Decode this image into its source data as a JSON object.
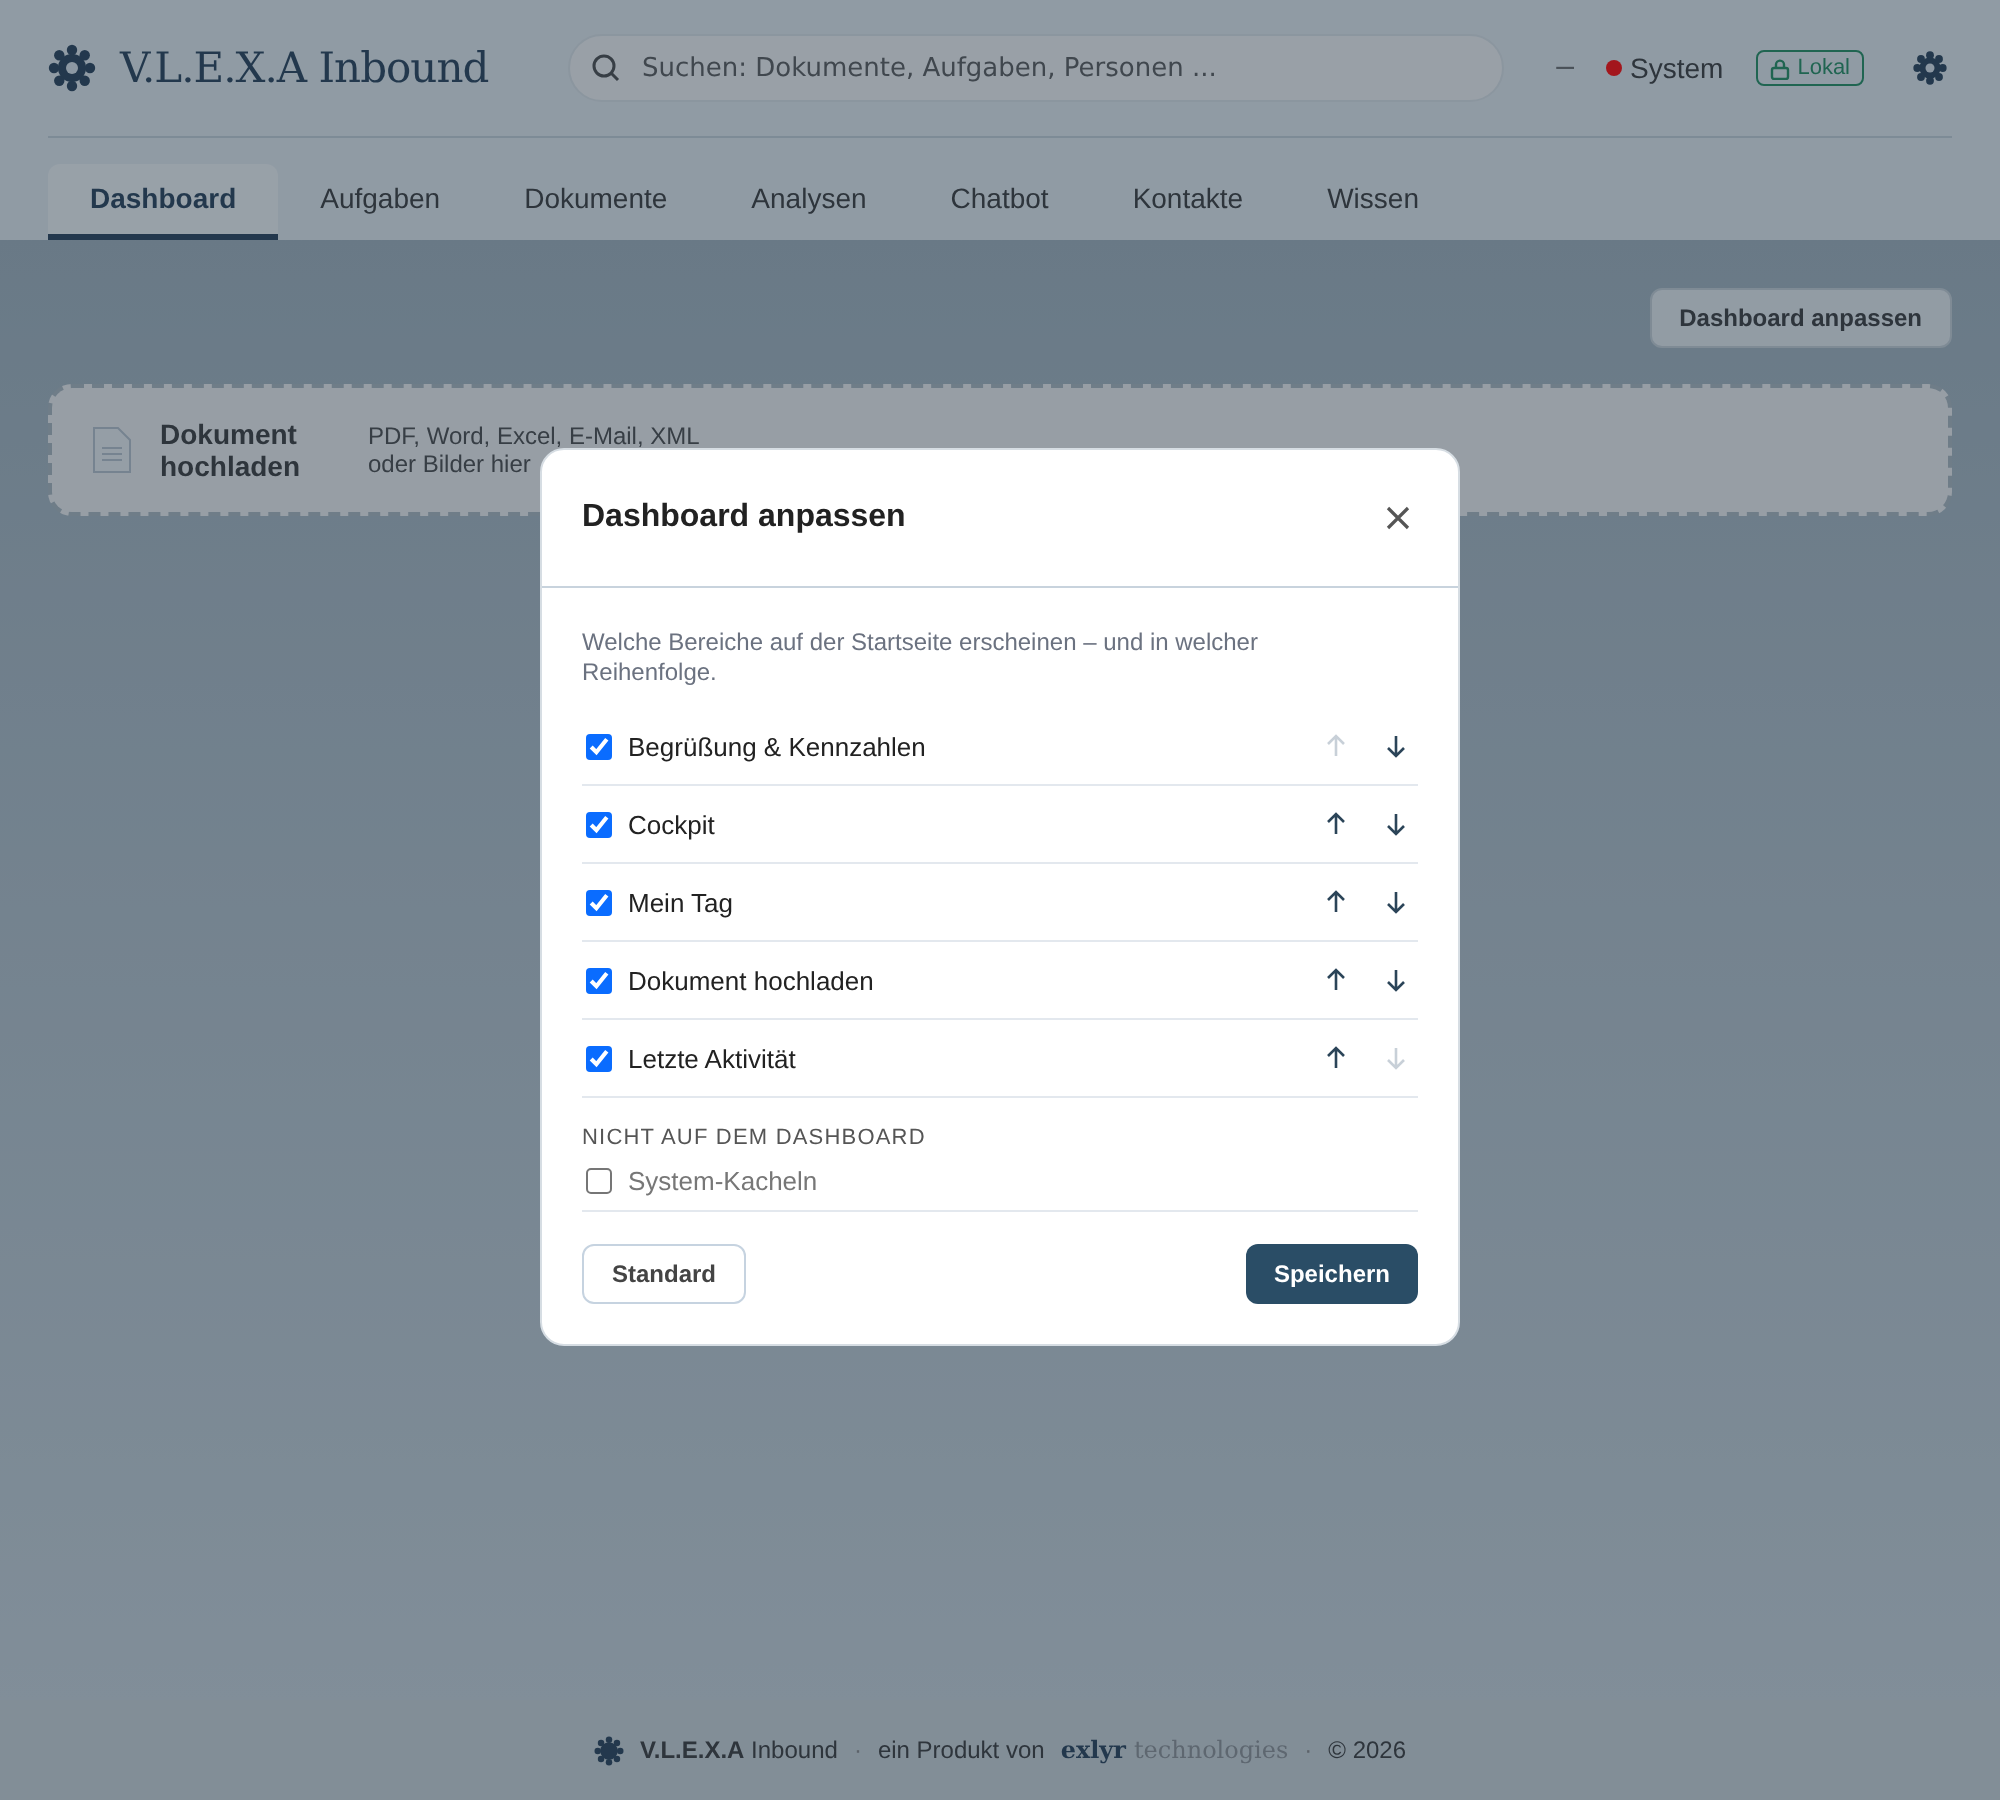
{
  "header": {
    "brand": "V.L.E.X.A Inbound",
    "search": {
      "placeholder": "Suchen: Dokumente, Aufgaben, Personen ..."
    },
    "dash": "–",
    "status": {
      "label": "System",
      "color": "#a3161c"
    },
    "badge": "Lokal"
  },
  "tabs": [
    {
      "label": "Dashboard",
      "selected": true
    },
    {
      "label": "Aufgaben",
      "selected": false
    },
    {
      "label": "Dokumente",
      "selected": false
    },
    {
      "label": "Analysen",
      "selected": false
    },
    {
      "label": "Chatbot",
      "selected": false
    },
    {
      "label": "Kontakte",
      "selected": false
    },
    {
      "label": "Wissen",
      "selected": false
    }
  ],
  "customize_button": "Dashboard anpassen",
  "upload_card": {
    "title": "Dokument hochladen",
    "line_1": "PDF, Word, Excel, E-Mail, XML",
    "line_2": "oder Bilder hier"
  },
  "dialog": {
    "title": "Dashboard anpassen",
    "intro": "Welche Bereiche auf der Startseite erscheinen – und in welcher Reihenfolge.",
    "sections": [
      {
        "label": "Begrüßung & Kennzahlen",
        "checked": true,
        "up_disabled": true,
        "down_disabled": false
      },
      {
        "label": "Cockpit",
        "checked": true,
        "up_disabled": false,
        "down_disabled": false
      },
      {
        "label": "Mein Tag",
        "checked": true,
        "up_disabled": false,
        "down_disabled": false
      },
      {
        "label": "Dokument hochladen",
        "checked": true,
        "up_disabled": false,
        "down_disabled": false
      },
      {
        "label": "Letzte Aktivität",
        "checked": true,
        "up_disabled": false,
        "down_disabled": true
      }
    ],
    "hidden_heading": "NICHT AUF DEM DASHBOARD",
    "hidden_sections": [
      {
        "label": "System-Kacheln",
        "checked": false
      }
    ],
    "reset_button": "Standard",
    "save_button": "Speichern"
  },
  "footer": {
    "product": "**V.L.E.X.A** Inbound",
    "separator_1": "·",
    "by": "ein Produkt von",
    "company": "exlyr",
    "company_suffix": "technologies",
    "separator_2": "·",
    "copyright": "© 2026"
  }
}
